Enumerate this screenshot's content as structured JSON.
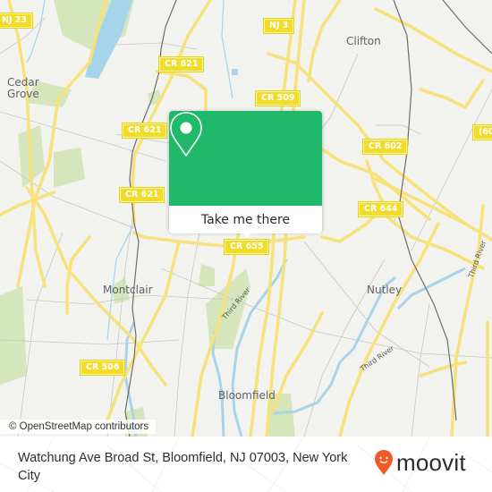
{
  "map": {
    "places": [
      {
        "id": "cedar-grove",
        "name": "Cedar\nGrove"
      },
      {
        "id": "clifton",
        "name": "Clifton"
      },
      {
        "id": "montclair",
        "name": "Montclair"
      },
      {
        "id": "nutley",
        "name": "Nutley"
      },
      {
        "id": "bloomfield",
        "name": "Bloomfield"
      }
    ],
    "road_shields": [
      {
        "id": "nj23",
        "label": "NJ 23"
      },
      {
        "id": "nj3",
        "label": "NJ 3"
      },
      {
        "id": "cr621a",
        "label": "CR 621"
      },
      {
        "id": "cr621b",
        "label": "CR 621"
      },
      {
        "id": "cr621c",
        "label": "CR 621"
      },
      {
        "id": "cr509",
        "label": "CR 509"
      },
      {
        "id": "cr602",
        "label": "CR 602"
      },
      {
        "id": "cr60x",
        "label": "(60"
      },
      {
        "id": "cr644",
        "label": "CR 644"
      },
      {
        "id": "cr655",
        "label": "CR 655"
      },
      {
        "id": "cr506",
        "label": "CR 506"
      }
    ],
    "water_labels": [
      {
        "id": "third-river-1",
        "label": "Third River"
      },
      {
        "id": "third-river-2",
        "label": "Third River"
      },
      {
        "id": "third-river-3",
        "label": "Third River"
      }
    ],
    "attribution": "© OpenStreetMap contributors"
  },
  "popup": {
    "action_label": "Take me there",
    "accent_color": "#20b869"
  },
  "footer": {
    "address": "Watchung Ave Broad St, Bloomfield, NJ 07003, New York City",
    "brand": "moovit",
    "brand_color": "#f05a28"
  }
}
